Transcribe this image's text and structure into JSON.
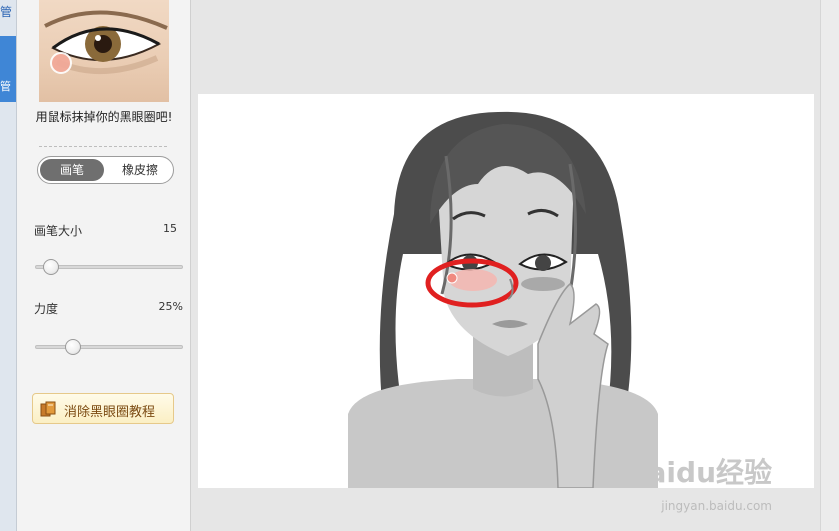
{
  "left_strip": {
    "top_char": "管",
    "tab_char": "管"
  },
  "side_panel": {
    "preview_hint": "用鼠标抹掉你的黑眼圈吧!",
    "tools": {
      "brush_label": "画笔",
      "eraser_label": "橡皮擦",
      "active": "brush"
    },
    "brush_size": {
      "label": "画笔大小",
      "value": "15",
      "level": 0.1
    },
    "strength": {
      "label": "力度",
      "value": "25%",
      "level": 0.25
    },
    "tutorial_button_label": "消除黑眼圈教程"
  },
  "watermark": {
    "logo": "Baidu经验",
    "url": "jingyan.baidu.com"
  },
  "colors": {
    "accent_blue": "#3f86d6",
    "active_tool": "#6f6f6f",
    "annotation_red": "#e02020",
    "skin": "#f1d9c4"
  }
}
